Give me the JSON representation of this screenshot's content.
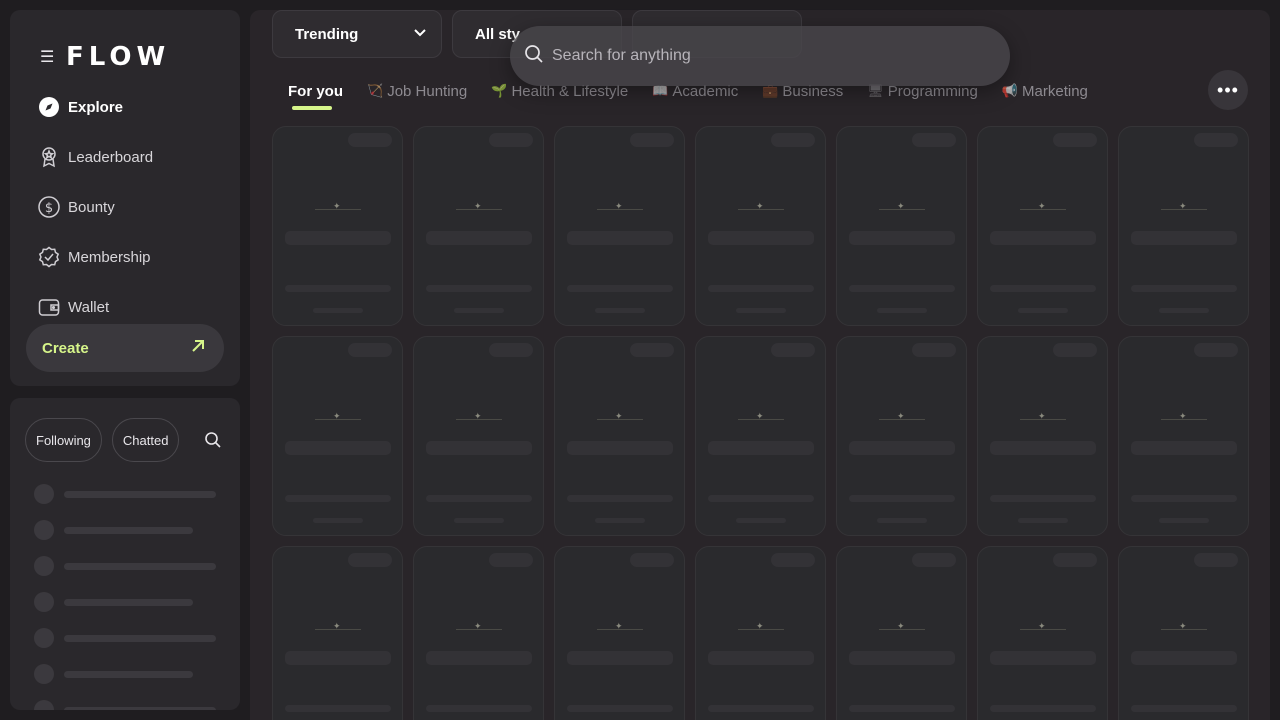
{
  "brand": {
    "logo": "FLOW"
  },
  "nav": [
    {
      "label": "Explore",
      "icon": "compass-icon"
    },
    {
      "label": "Leaderboard",
      "icon": "award-icon"
    },
    {
      "label": "Bounty",
      "icon": "dollar-icon"
    },
    {
      "label": "Membership",
      "icon": "badge-check-icon"
    },
    {
      "label": "Wallet",
      "icon": "wallet-icon"
    }
  ],
  "create": {
    "label": "Create"
  },
  "chats": {
    "following": "Following",
    "chatted": "Chatted"
  },
  "filters": {
    "sort": "Trending",
    "style": "All sty"
  },
  "search": {
    "placeholder": "Search for anything"
  },
  "tabs": [
    {
      "label": "For you",
      "emoji": ""
    },
    {
      "label": "Job Hunting",
      "emoji": "🏹"
    },
    {
      "label": "Health & Lifestyle",
      "emoji": "🌱"
    },
    {
      "label": "Academic",
      "emoji": "📖"
    },
    {
      "label": "Business",
      "emoji": "💼"
    },
    {
      "label": "Programming",
      "emoji": "🖥"
    },
    {
      "label": "Marketing",
      "emoji": "📢"
    }
  ],
  "colors": {
    "accent": "#d6f58a"
  }
}
